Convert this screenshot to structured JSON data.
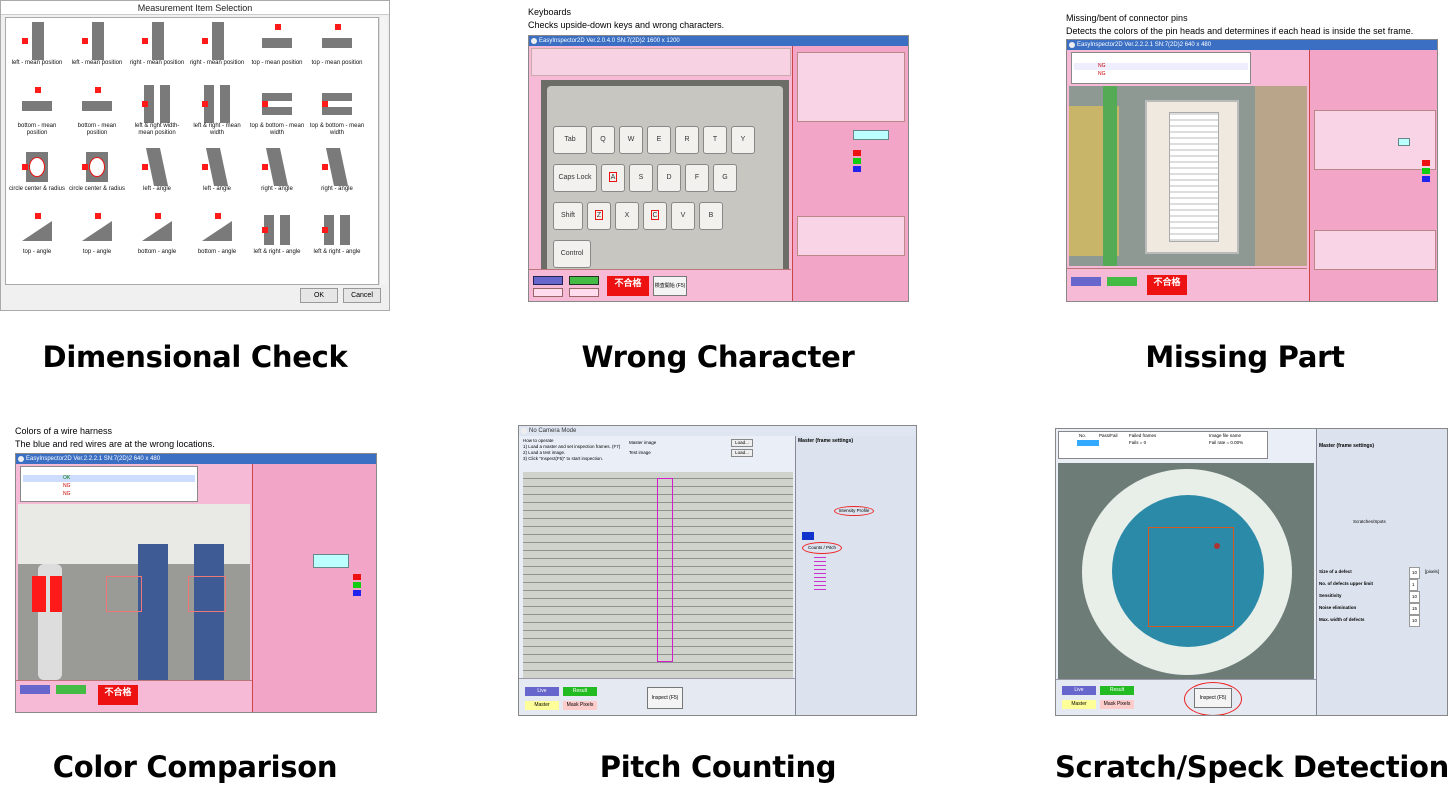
{
  "panels": {
    "dimensional": {
      "caption": "Dimensional Check",
      "dialog_title": "Measurement Item Selection",
      "ok_label": "OK",
      "cancel_label": "Cancel",
      "items": [
        "left - mean position",
        "left - mean position",
        "right - mean position",
        "right - mean position",
        "top - mean position",
        "top - mean position",
        "bottom - mean position",
        "bottom - mean position",
        "left & right width-mean position",
        "left & right - mean width",
        "top & bottom - mean width",
        "top & bottom - mean width",
        "circle center & radius",
        "circle center & radius",
        "left - angle",
        "left - angle",
        "right - angle",
        "right - angle",
        "top - angle",
        "top - angle",
        "bottom - angle",
        "bottom - angle",
        "left & right - angle",
        "left & right - angle"
      ]
    },
    "wrong_character": {
      "caption": "Wrong Character",
      "heading": "Keyboards",
      "subheading": "Checks upside-down keys and wrong characters.",
      "window_title": "EasyInspector2D Ver.2.0.4.0  SN:7(2D)2  1600 x 1200",
      "result_label": "不合格",
      "inspect_label": "検査開始 (F5)",
      "keys": [
        "Tab",
        "Q",
        "W",
        "E",
        "R",
        "T",
        "Y",
        "Caps Lock",
        "A",
        "S",
        "D",
        "F",
        "G",
        "Shift",
        "Z",
        "X",
        "C",
        "V",
        "B",
        "Control"
      ]
    },
    "missing_part": {
      "caption": "Missing Part",
      "heading": "Missing/bent of connector pins",
      "subheading": "Detects the colors of the pin heads and determines if each head is inside the set frame.",
      "window_title": "EasyInspector2D Ver.2.2.2.1  SN:7(2D)2  640 x 480",
      "result_label": "不合格",
      "table_rows": [
        "NG",
        "NG"
      ]
    },
    "color_comparison": {
      "caption": "Color Comparison",
      "heading": "Colors of a wire harness",
      "subheading": "The blue and red wires are at the wrong locations.",
      "window_title": "EasyInspector2D Ver.2.2.2.1  SN:7(2D)2  640 x 480",
      "result_label": "不合格",
      "table_rows": [
        "OK",
        "NG",
        "NG"
      ]
    },
    "pitch_counting": {
      "caption": "Pitch Counting",
      "window_title": "No Camera Mode",
      "howto_title": "How to operate",
      "howto_lines": [
        "1) Load a master and set inspection frames. (F7)",
        "2) Load a test image.",
        "3) Click \"Inspect(F5)\" to start inspection."
      ],
      "master_image_label": "Master image",
      "test_image_label": "Test image",
      "load_label": "Load...",
      "inspect_label": "Inspect (F5)",
      "live_label": "Live",
      "result_label": "Result",
      "master_label": "Master",
      "mask_label": "Mask Pixels",
      "panel_title": "Master (frame settings)",
      "intensity_profile": "Intensity Profile",
      "count_pitch": "Counts / Pitch"
    },
    "scratch": {
      "caption": "Scratch/Speck Detection",
      "col_no": "No.",
      "col_passfail": "Pass/Fail",
      "col_failed": "Failed frames",
      "col_image": "Image file name",
      "fails_text": "Fails = 0",
      "fail_rate_text": "Fail rate = 0.00%",
      "panel_title": "Master (frame settings)",
      "scratches_tab": "Scratches/Spots",
      "inspect_label": "Inspect (F5)",
      "live_label": "Live",
      "result_label": "Result",
      "master_label": "Master",
      "mask_label": "Mask Pixels",
      "params": [
        "Size of a defect",
        "No. of defects upper limit",
        "Sensitivity",
        "Noise elimination",
        "Max. width of defects"
      ],
      "param_values": [
        "10",
        "1",
        "10",
        "15",
        "10"
      ],
      "unit": "[pixels]"
    }
  },
  "colors": {
    "pink": "#f3a5c8",
    "red": "#ff1a1a",
    "titlebar": "#3a6fc4",
    "camera_bg": "#d9d9d9"
  }
}
